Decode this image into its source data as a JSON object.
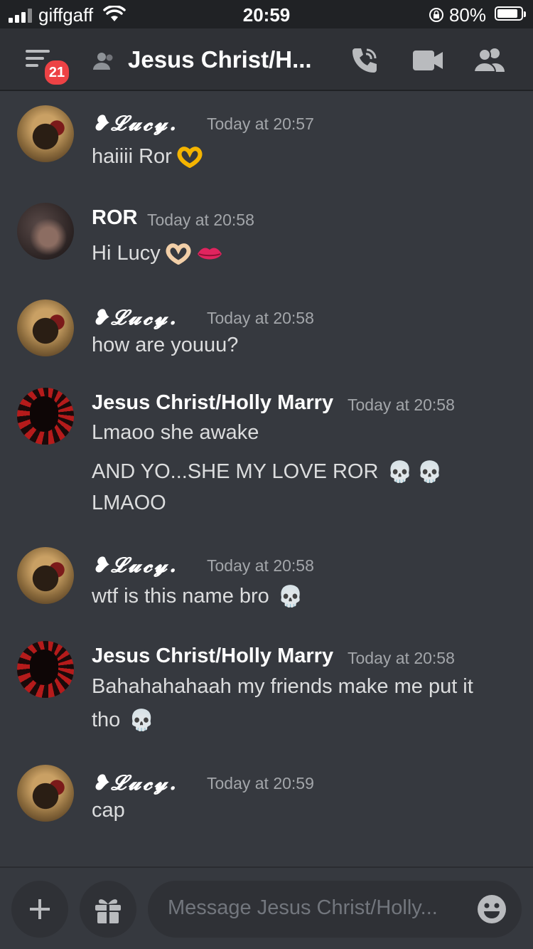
{
  "status_bar": {
    "carrier": "giffgaff",
    "time": "20:59",
    "battery": "80%"
  },
  "header": {
    "unread_badge": "21",
    "title": "Jesus Christ/H..."
  },
  "messages": [
    {
      "author": "❥𝓛𝓾𝓬𝔂.",
      "timestamp": "Today at 20:57",
      "lines": [
        "haiiii Ror"
      ],
      "avatar": "lucy-avatar"
    },
    {
      "author": "ROR",
      "timestamp": "Today at 20:58",
      "lines": [
        "Hi Lucy"
      ],
      "avatar": "ror-avatar"
    },
    {
      "author": "❥𝓛𝓾𝓬𝔂.",
      "timestamp": "Today at 20:58",
      "lines": [
        "how are youuu?"
      ],
      "avatar": "lucy-avatar"
    },
    {
      "author": "Jesus Christ/Holly Marry",
      "timestamp": "Today at 20:58",
      "lines": [
        "Lmaoo she awake",
        "AND YO...SHE MY LOVE ROR",
        "LMAOO"
      ],
      "avatar": "jesus-avatar"
    },
    {
      "author": "❥𝓛𝓾𝓬𝔂.",
      "timestamp": "Today at 20:58",
      "lines": [
        "wtf is this name bro"
      ],
      "avatar": "lucy-avatar"
    },
    {
      "author": "Jesus Christ/Holly Marry",
      "timestamp": "Today at 20:58",
      "lines": [
        "Bahahahahaah my friends make me put it",
        "tho"
      ],
      "avatar": "jesus-avatar"
    },
    {
      "author": "❥𝓛𝓾𝓬𝔂.",
      "timestamp": "Today at 20:59",
      "lines": [
        "cap"
      ],
      "avatar": "lucy-avatar"
    }
  ],
  "composer": {
    "placeholder": "Message Jesus Christ/Holly..."
  },
  "colors": {
    "background": "#36393f",
    "header": "#2f3136",
    "badge": "#ed4245",
    "timestamp": "#a3a6aa"
  },
  "icons": [
    "signal-icon",
    "wifi-icon",
    "rotation-lock-icon",
    "battery-icon",
    "menu-icon",
    "dm-user-icon",
    "call-icon",
    "video-icon",
    "members-icon",
    "plus-icon",
    "gift-icon",
    "emoji-icon",
    "heart-hands-emoji",
    "lips-emoji",
    "skull-emoji"
  ]
}
